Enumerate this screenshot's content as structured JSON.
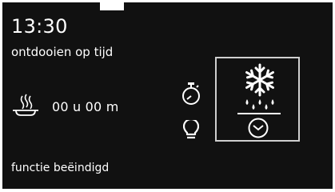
{
  "header": {
    "time": "13:30",
    "program": "ontdooien op tijd"
  },
  "duration": {
    "icon": "pan-icon",
    "value": "00 u 00 m"
  },
  "side_icons": [
    "timer-icon",
    "lamp-icon"
  ],
  "function_panel": {
    "icon": "defrost-icon",
    "sub_icon": "clock-icon"
  },
  "status": {
    "text": "functie beëindigd"
  },
  "colors": {
    "background": "#111111",
    "foreground": "#ffffff",
    "panel_border": "#cfcfcf"
  }
}
